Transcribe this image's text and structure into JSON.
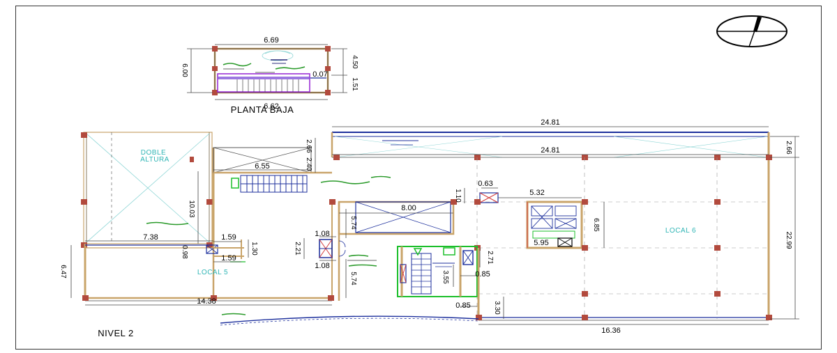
{
  "labels": {
    "planta_baja": "PLANTA BAJA",
    "nivel_2": "NIVEL 2",
    "local_5": "LOCAL 5",
    "local_6": "LOCAL 6",
    "doble": "DOBLE",
    "altura": "ALTURA"
  },
  "dimensions": {
    "pb_top": "6.69",
    "pb_bottom": "6.62",
    "pb_left": "6.00",
    "pb_right_upper": "4.50",
    "pb_right_lower": "1.51",
    "pb_inner": "0.07",
    "top_overall": "24.81",
    "top_inner": "24.81",
    "right_top": "2.66",
    "right_overall": "22.99",
    "void_top": "2.66",
    "void_side": "2.40",
    "void_width": "6.55",
    "core_width": "8.00",
    "core_height": "5.74",
    "small_a": "0.63",
    "small_b": "1.10",
    "bath_width": "5.32",
    "bath_height": "6.85",
    "bath_bottom": "5.95",
    "doble_height": "10.03",
    "mid_width": "7.38",
    "stub_a": "1.59",
    "stub_b": "1.59",
    "stub_c": "1.30",
    "stub_d": "0.98",
    "shaft_a": "1.08",
    "shaft_b": "1.08",
    "shaft_c": "2.21",
    "lower_left_h": "5.74",
    "stair_h": "3.55",
    "stair_w": "0.85",
    "stair_w2": "0.85",
    "stair_side": "2.71",
    "left_h": "6.47",
    "bottom_left": "14.38",
    "bottom_right": "16.36",
    "bottom_right_h": "3.30"
  }
}
